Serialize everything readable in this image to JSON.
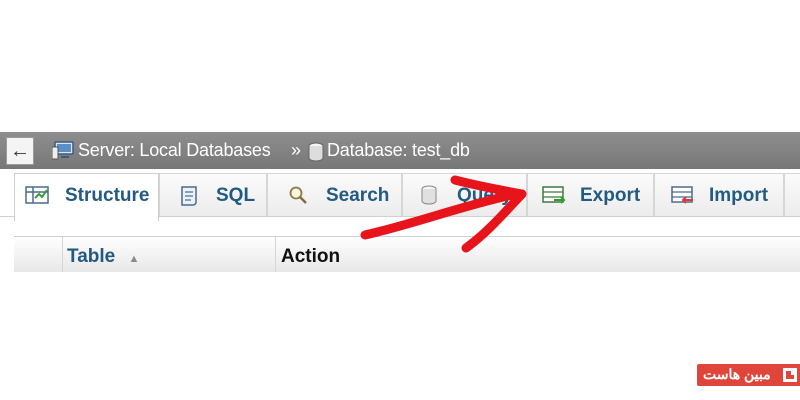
{
  "nav": {
    "back_symbol": "←",
    "server_label": "Server: Local Databases",
    "separator": "»",
    "database_label": "Database: test_db"
  },
  "tabs": [
    {
      "label": "Structure",
      "icon": "structure-icon",
      "active": true
    },
    {
      "label": "SQL",
      "icon": "sql-icon",
      "active": false
    },
    {
      "label": "Search",
      "icon": "search-icon",
      "active": false
    },
    {
      "label": "Query",
      "icon": "query-icon",
      "active": false
    },
    {
      "label": "Export",
      "icon": "export-icon",
      "active": false
    },
    {
      "label": "Import",
      "icon": "import-icon",
      "active": false
    }
  ],
  "table": {
    "headers": [
      "Table",
      "Action"
    ],
    "sort_indicator": "▲"
  },
  "annotation": {
    "type": "red-hand-drawn-arrow",
    "points_to": "Export",
    "color": "#e8141b"
  },
  "watermark": {
    "text": "مبین هاست",
    "background": "#e0453b"
  },
  "colors": {
    "tab_text": "#235a81",
    "topbar": "#808080"
  }
}
